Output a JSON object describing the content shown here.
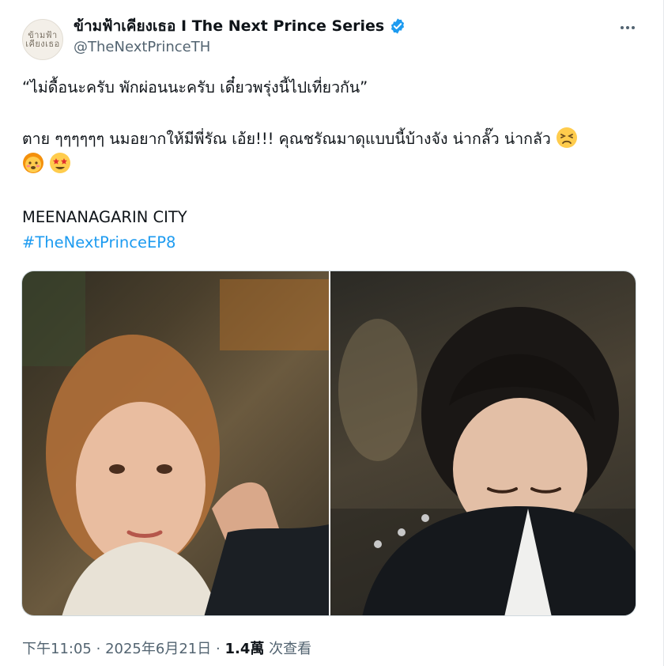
{
  "author": {
    "display_name": "ข้ามฟ้าเคียงเธอ I The Next Prince Series",
    "handle": "@TheNextPrinceTH",
    "avatar_text": "ข้ามฟ้า เคียงเธอ",
    "verified": true,
    "verified_color": "#1d9bf0"
  },
  "tweet": {
    "line1": "“ไม่ดื้อนะครับ พักผ่อนนะครับ เดี๋ยวพรุ่งนี้ไปเที่ยวกัน”",
    "line2": "ตาย ๆๆๆๆๆๆ นมอยากให้มีพี่รัณ เอ้ย!!! คุณชรัณมาดุแบบนี้บ้างจัง น่ากลั๊ว น่ากลัว",
    "line2_emojis": [
      "tired-face-emoji"
    ],
    "line3_emojis": [
      "hot-face-emoji",
      "star-struck-emoji"
    ],
    "location": "MEENANAGARIN CITY",
    "hashtag": "#TheNextPrinceEP8",
    "hashtag_color": "#1d9bf0"
  },
  "media": {
    "photos": [
      {
        "name": "photo-left",
        "description_icon": "portrait-image"
      },
      {
        "name": "photo-right",
        "description_icon": "portrait-image"
      }
    ]
  },
  "footer": {
    "time": "下午11:05",
    "separator": "·",
    "date": "2025年6月21日",
    "views_count": "1.4萬",
    "views_label": "次查看"
  }
}
